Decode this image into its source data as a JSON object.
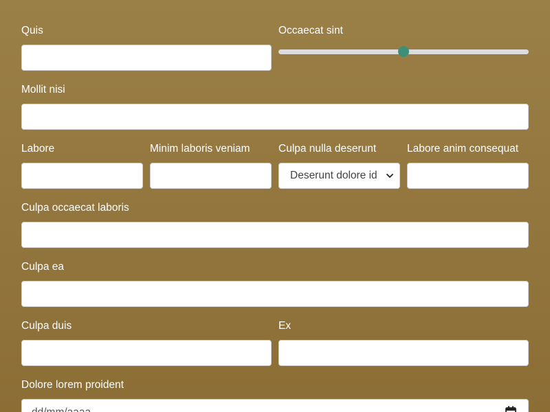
{
  "rows": [
    [
      {
        "label": "Quis",
        "type": "text",
        "value": ""
      },
      {
        "label": "Occaecat sint",
        "type": "range",
        "value": 0.5
      }
    ],
    [
      {
        "label": "Mollit nisi",
        "type": "text",
        "value": ""
      }
    ],
    [
      {
        "label": "Labore",
        "type": "text",
        "value": ""
      },
      {
        "label": "Minim laboris veniam",
        "type": "text",
        "value": ""
      },
      {
        "label": "Culpa nulla deserunt",
        "type": "select",
        "selected": "Deserunt dolore id"
      },
      {
        "label": "Labore anim consequat",
        "type": "text",
        "value": ""
      }
    ],
    [
      {
        "label": "Culpa occaecat laboris",
        "type": "text",
        "value": ""
      }
    ],
    [
      {
        "label": "Culpa ea",
        "type": "text",
        "value": ""
      }
    ],
    [
      {
        "label": "Culpa duis",
        "type": "text",
        "value": ""
      },
      {
        "label": "Ex",
        "type": "text",
        "value": ""
      }
    ],
    [
      {
        "label": "Dolore lorem proident",
        "type": "date",
        "placeholder": "dd/mm/aaaa"
      }
    ]
  ],
  "colors": {
    "background_top": "#9a7f47",
    "background_bottom": "#8c6e35",
    "slider_thumb": "#3f8f78",
    "slider_track": "#dcdcdc"
  },
  "icons": {
    "select_arrow": "chevron-down-icon",
    "date_picker": "calendar-icon"
  }
}
